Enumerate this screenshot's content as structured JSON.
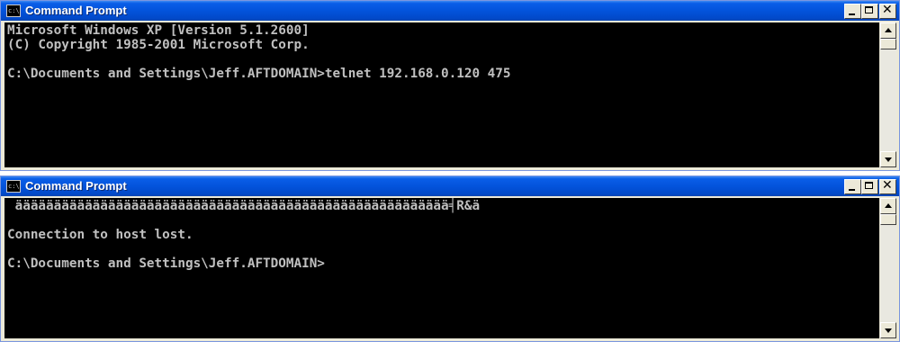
{
  "windows": [
    {
      "title": "Command Prompt",
      "icon": "console-icon",
      "lines": [
        "Microsoft Windows XP [Version 5.1.2600]",
        "(C) Copyright 1985-2001 Microsoft Corp.",
        "",
        "C:\\Documents and Settings\\Jeff.AFTDOMAIN>telnet 192.168.0.120 475"
      ]
    },
    {
      "title": "Command Prompt",
      "icon": "console-icon",
      "lines": [
        " ääääääääääääääääääääääääääääääääääääääääääääääääääääääää╡R&ä",
        "",
        "Connection to host lost.",
        "",
        "C:\\Documents and Settings\\Jeff.AFTDOMAIN>"
      ]
    }
  ],
  "controls": {
    "minimize": "_",
    "maximize": "□",
    "close": "✕"
  },
  "colors": {
    "titlebar": "#0353db",
    "console_bg": "#000000",
    "console_text": "#c0c0c0",
    "frame": "#ece9d8"
  }
}
